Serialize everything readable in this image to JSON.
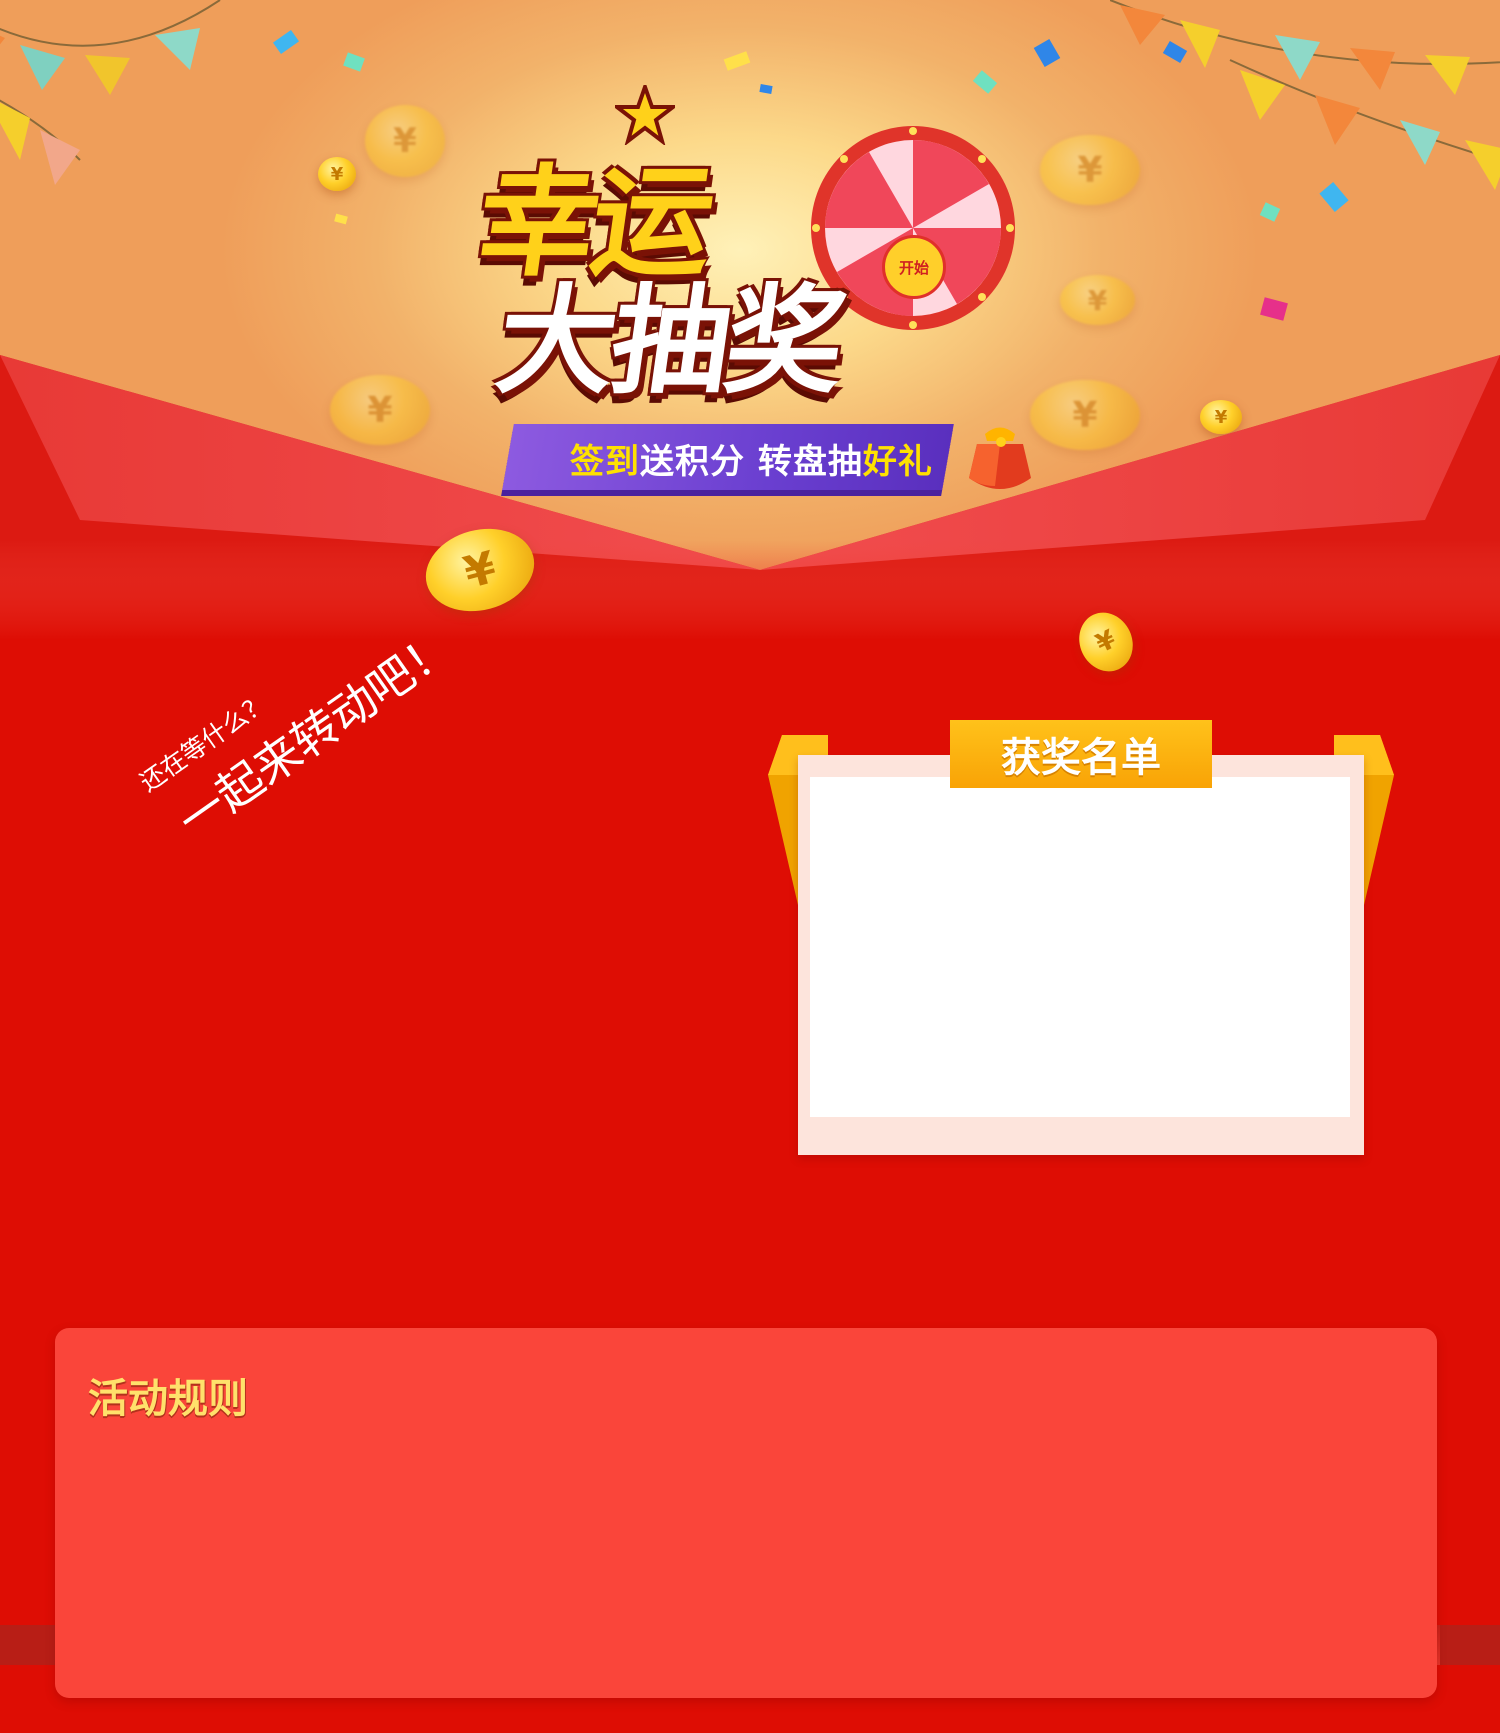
{
  "hero": {
    "title_line1": "幸运",
    "title_line2": "大抽奖",
    "wheel_start_label": "开始",
    "tagline_part1": "签到",
    "tagline_part2": "送积分",
    "tagline_part3": "转盘抽",
    "tagline_part4": "好礼",
    "coin_symbol": "¥"
  },
  "slogan": {
    "small": "还在等什么？",
    "big": "一起来转动吧！"
  },
  "winners": {
    "title": "获奖名单"
  },
  "rules": {
    "title": "活动规则"
  },
  "colors": {
    "page_red": "#de0d04",
    "rules_panel": "#fa453a",
    "winners_header": "#ffc21a",
    "rules_title": "#ffe16b",
    "tagline_yellow": "#ffe100",
    "ribbon_purple": "#6a3fd0"
  }
}
